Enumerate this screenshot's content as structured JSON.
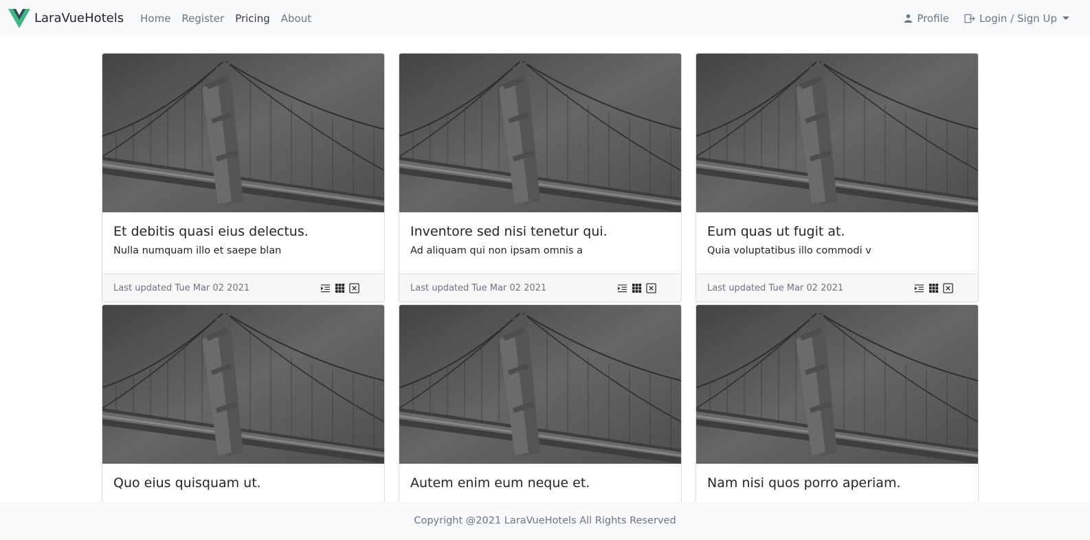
{
  "nav": {
    "brand": "LaraVueHotels",
    "links": [
      {
        "label": "Home",
        "active": false
      },
      {
        "label": "Register",
        "active": false
      },
      {
        "label": "Pricing",
        "active": true
      },
      {
        "label": "About",
        "active": false
      }
    ],
    "profile": "Profile",
    "login": "Login / Sign Up"
  },
  "cards": [
    {
      "title": "Et debitis quasi eius delectus.",
      "text": "Nulla numquam illo et saepe blan",
      "footer": "Last updated Tue Mar 02 2021"
    },
    {
      "title": "Inventore sed nisi tenetur qui.",
      "text": "Ad aliquam qui non ipsam omnis a",
      "footer": "Last updated Tue Mar 02 2021"
    },
    {
      "title": "Eum quas ut fugit at.",
      "text": "Quia voluptatibus illo commodi v",
      "footer": "Last updated Tue Mar 02 2021"
    },
    {
      "title": "Quo eius quisquam ut.",
      "text": "",
      "footer": ""
    },
    {
      "title": "Autem enim eum neque et.",
      "text": "",
      "footer": ""
    },
    {
      "title": "Nam nisi quos porro aperiam.",
      "text": "",
      "footer": ""
    }
  ],
  "footer": {
    "copyright": "Copyright @2021 LaraVueHotels All Rights Reserved"
  },
  "colors": {
    "brand_green": "#41b883",
    "brand_dark": "#35495e"
  },
  "icons": [
    "vue-logo-icon",
    "user-icon",
    "sign-in-icon",
    "indent-list-icon",
    "grid-icon",
    "close-box-icon",
    "bridge-photo"
  ]
}
